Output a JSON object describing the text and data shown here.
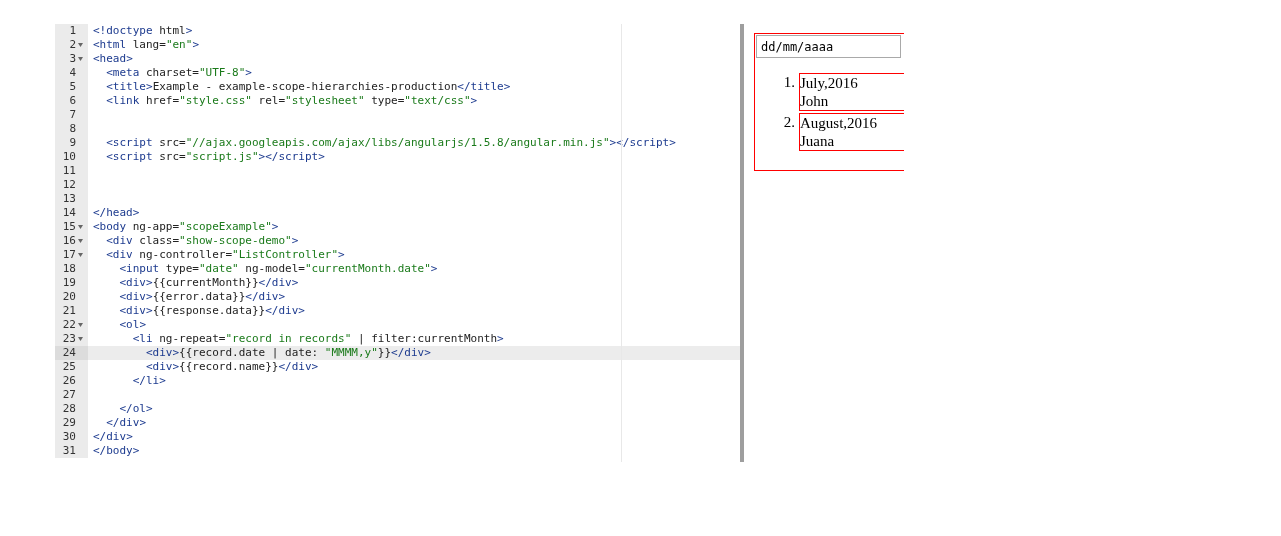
{
  "editor": {
    "lines": [
      {
        "number": "1",
        "text": "<!doctype html>",
        "foldable": false,
        "current": false
      },
      {
        "number": "2",
        "text": "<html lang=\"en\">",
        "foldable": true,
        "current": false
      },
      {
        "number": "3",
        "text": "<head>",
        "foldable": true,
        "current": false
      },
      {
        "number": "4",
        "text": "  <meta charset=\"UTF-8\">",
        "foldable": false,
        "current": false
      },
      {
        "number": "5",
        "text": "  <title>Example - example-scope-hierarchies-production</title>",
        "foldable": false,
        "current": false
      },
      {
        "number": "6",
        "text": "  <link href=\"style.css\" rel=\"stylesheet\" type=\"text/css\">",
        "foldable": false,
        "current": false
      },
      {
        "number": "7",
        "foldable": false,
        "current": false
      },
      {
        "number": "8",
        "foldable": false,
        "current": false
      },
      {
        "number": "9",
        "text": "  <script src=\"//ajax.googleapis.com/ajax/libs/angularjs/1.5.8/angular.min.js\"></script>",
        "foldable": false,
        "current": false
      },
      {
        "number": "10",
        "text": "  <script src=\"script.js\"></script>",
        "foldable": false,
        "current": false
      },
      {
        "number": "11",
        "foldable": false,
        "current": false
      },
      {
        "number": "12",
        "foldable": false,
        "current": false
      },
      {
        "number": "13",
        "foldable": false,
        "current": false
      },
      {
        "number": "14",
        "text": "</head>",
        "foldable": false,
        "current": false
      },
      {
        "number": "15",
        "text": "<body ng-app=\"scopeExample\">",
        "foldable": true,
        "current": false
      },
      {
        "number": "16",
        "text": "  <div class=\"show-scope-demo\">",
        "foldable": true,
        "current": false
      },
      {
        "number": "17",
        "text": "  <div ng-controller=\"ListController\">",
        "foldable": true,
        "current": false
      },
      {
        "number": "18",
        "text": "    <input type=\"date\" ng-model=\"currentMonth.date\">",
        "foldable": false,
        "current": false
      },
      {
        "number": "19",
        "text": "    <div>{{currentMonth}}</div>",
        "foldable": false,
        "current": false
      },
      {
        "number": "20",
        "text": "    <div>{{error.data}}</div>",
        "foldable": false,
        "current": false
      },
      {
        "number": "21",
        "text": "    <div>{{response.data}}</div>",
        "foldable": false,
        "current": false
      },
      {
        "number": "22",
        "text": "    <ol>",
        "foldable": true,
        "current": false
      },
      {
        "number": "23",
        "text": "      <li ng-repeat=\"record in records\" | filter:currentMonth>",
        "foldable": true,
        "current": false
      },
      {
        "number": "24",
        "text": "        <div>{{record.date | date: \"MMMM,y\"}}</div>",
        "foldable": false,
        "current": true
      },
      {
        "number": "25",
        "text": "        <div>{{record.name}}</div>",
        "foldable": false,
        "current": false
      },
      {
        "number": "26",
        "text": "      </li>",
        "foldable": false,
        "current": false
      },
      {
        "number": "27",
        "foldable": false,
        "current": false
      },
      {
        "number": "28",
        "text": "    </ol>",
        "foldable": false,
        "current": false
      },
      {
        "number": "29",
        "text": "  </div>",
        "foldable": false,
        "current": false
      },
      {
        "number": "30",
        "text": "</div>",
        "foldable": false,
        "current": false
      },
      {
        "number": "31",
        "text": "</body>",
        "foldable": false,
        "current": false
      }
    ]
  },
  "preview": {
    "date_input": {
      "value": "dd/mm/aaaa"
    },
    "items": [
      {
        "marker": "1.",
        "date": "July,2016",
        "name": "John"
      },
      {
        "marker": "2.",
        "date": "August,2016",
        "name": "Juana"
      }
    ]
  }
}
